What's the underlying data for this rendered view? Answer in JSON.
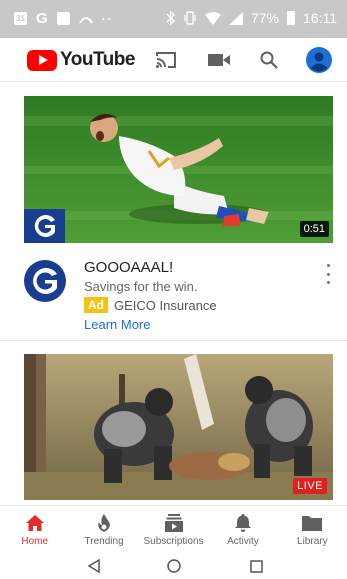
{
  "status_bar": {
    "left_badge": "31",
    "battery": "77%",
    "time": "16:11"
  },
  "app_bar": {
    "logo_text": "YouTube"
  },
  "ad": {
    "duration": "0:51",
    "title": "GOOOAAAL!",
    "subtitle": "Savings for the win.",
    "badge": "Ad",
    "advertiser": "GEICO Insurance",
    "cta": "Learn More",
    "brand_letter": "G"
  },
  "live_video": {
    "badge": "LIVE"
  },
  "bottom_nav": {
    "items": [
      {
        "label": "Home",
        "icon": "home-icon",
        "active": true
      },
      {
        "label": "Trending",
        "icon": "flame-icon",
        "active": false
      },
      {
        "label": "Subscriptions",
        "icon": "subscriptions-icon",
        "active": false
      },
      {
        "label": "Activity",
        "icon": "bell-icon",
        "active": false
      },
      {
        "label": "Library",
        "icon": "folder-icon",
        "active": false
      }
    ]
  },
  "colors": {
    "brand_red": "#ff0000",
    "active_tab": "#e52d27",
    "link_blue": "#1e6fd4",
    "ad_badge": "#f6c20f",
    "live_red": "#e02020",
    "geico_blue": "#1a3e8f"
  }
}
